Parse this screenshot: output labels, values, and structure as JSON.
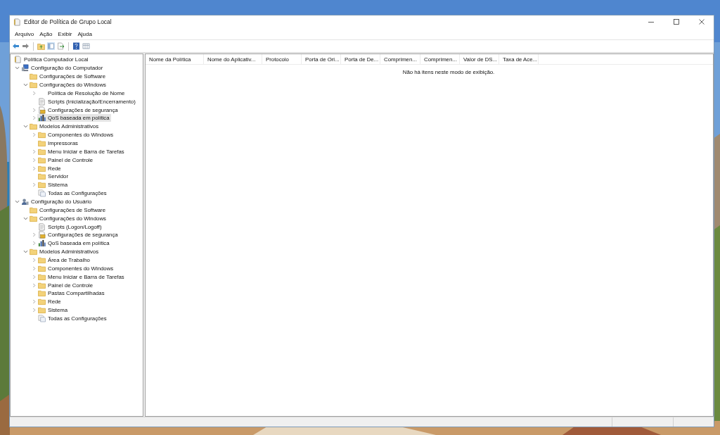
{
  "window": {
    "title": "Editor de Política de Grupo Local"
  },
  "menu": [
    "Arquivo",
    "Ação",
    "Exibir",
    "Ajuda"
  ],
  "tree": [
    {
      "label": "Política Computador Local",
      "kind": "policy",
      "selected": false,
      "children": [
        {
          "label": "Configuração do Computador",
          "kind": "computer",
          "selected": false,
          "expanded": true,
          "children": [
            {
              "label": "Configurações de Software",
              "kind": "folder",
              "selected": false
            },
            {
              "label": "Configurações do Windows",
              "kind": "folder",
              "selected": false,
              "expanded": true,
              "children": [
                {
                  "label": "Política de Resolução de Nome",
                  "kind": "blank",
                  "selected": false,
                  "expanded": false
                },
                {
                  "label": "Scripts (Inicialização/Encerramento)",
                  "kind": "script",
                  "selected": false
                },
                {
                  "label": "Configurações de segurança",
                  "kind": "security",
                  "selected": false,
                  "expanded": false
                },
                {
                  "label": "QoS baseada em política",
                  "kind": "qos",
                  "selected": true,
                  "expanded": false
                }
              ]
            },
            {
              "label": "Modelos Administrativos",
              "kind": "folder",
              "selected": false,
              "expanded": true,
              "children": [
                {
                  "label": "Componentes do Windows",
                  "kind": "folder",
                  "selected": false,
                  "expanded": false
                },
                {
                  "label": "Impressoras",
                  "kind": "folder",
                  "selected": false
                },
                {
                  "label": "Menu Iniciar e Barra de Tarefas",
                  "kind": "folder",
                  "selected": false,
                  "expanded": false
                },
                {
                  "label": "Painel de Controle",
                  "kind": "folder",
                  "selected": false,
                  "expanded": false
                },
                {
                  "label": "Rede",
                  "kind": "folder",
                  "selected": false,
                  "expanded": false
                },
                {
                  "label": "Servidor",
                  "kind": "folder",
                  "selected": false
                },
                {
                  "label": "Sistema",
                  "kind": "folder",
                  "selected": false,
                  "expanded": false
                },
                {
                  "label": "Todas as Configurações",
                  "kind": "settings",
                  "selected": false
                }
              ]
            }
          ]
        },
        {
          "label": "Configuração do Usuário",
          "kind": "user",
          "selected": false,
          "expanded": true,
          "children": [
            {
              "label": "Configurações de Software",
              "kind": "folder",
              "selected": false
            },
            {
              "label": "Configurações do Windows",
              "kind": "folder",
              "selected": false,
              "expanded": true,
              "children": [
                {
                  "label": "Scripts (Logon/Logoff)",
                  "kind": "script",
                  "selected": false
                },
                {
                  "label": "Configurações de segurança",
                  "kind": "security",
                  "selected": false,
                  "expanded": false
                },
                {
                  "label": "QoS baseada em política",
                  "kind": "qos",
                  "selected": false,
                  "expanded": false
                }
              ]
            },
            {
              "label": "Modelos Administrativos",
              "kind": "folder",
              "selected": false,
              "expanded": true,
              "children": [
                {
                  "label": "Área de Trabalho",
                  "kind": "folder",
                  "selected": false,
                  "expanded": false
                },
                {
                  "label": "Componentes do Windows",
                  "kind": "folder",
                  "selected": false,
                  "expanded": false
                },
                {
                  "label": "Menu Iniciar e Barra de Tarefas",
                  "kind": "folder",
                  "selected": false,
                  "expanded": false
                },
                {
                  "label": "Painel de Controle",
                  "kind": "folder",
                  "selected": false,
                  "expanded": false
                },
                {
                  "label": "Pastas Compartilhadas",
                  "kind": "folder",
                  "selected": false
                },
                {
                  "label": "Rede",
                  "kind": "folder",
                  "selected": false,
                  "expanded": false
                },
                {
                  "label": "Sistema",
                  "kind": "folder",
                  "selected": false,
                  "expanded": false
                },
                {
                  "label": "Todas as Configurações",
                  "kind": "settings",
                  "selected": false
                }
              ]
            }
          ]
        }
      ]
    }
  ],
  "columns": [
    "Nome da Política",
    "Nome do Aplicativ...",
    "Protocolo",
    "Porta de Ori...",
    "Porta de De...",
    "Comprimen...",
    "Comprimen...",
    "Valor de DS...",
    "Taxa de Ace..."
  ],
  "empty_message": "Não há itens neste modo de exibição."
}
